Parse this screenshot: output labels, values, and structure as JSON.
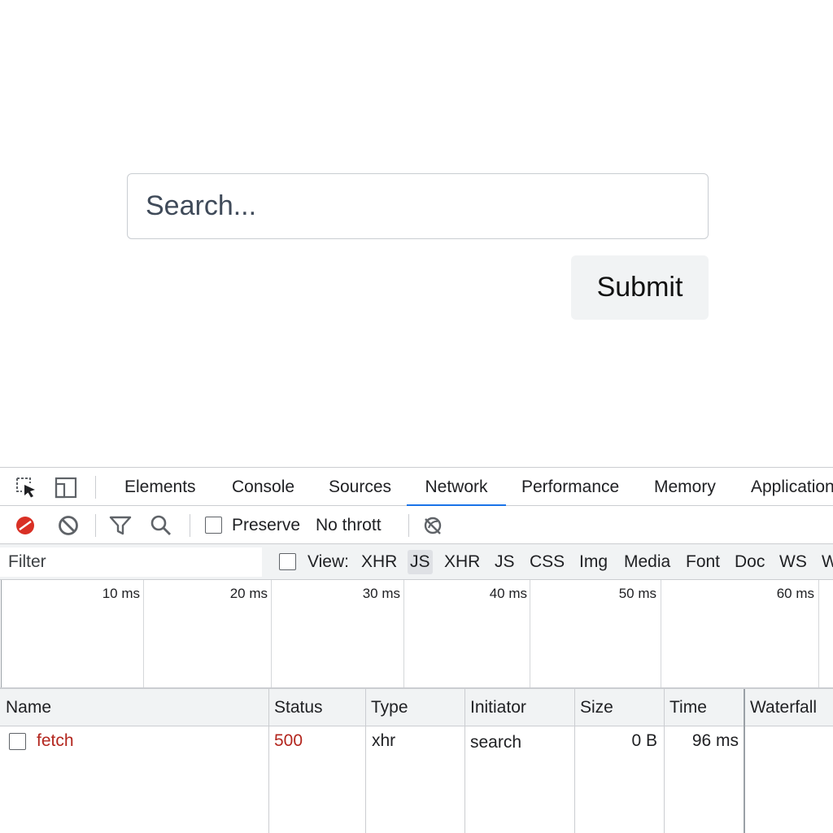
{
  "page": {
    "search_placeholder": "Search...",
    "submit_label": "Submit"
  },
  "devtools": {
    "tabs": [
      "Elements",
      "Console",
      "Sources",
      "Network",
      "Performance",
      "Memory",
      "Application"
    ],
    "active_tab": "Network",
    "accent_color": "#1a73e8",
    "toolbar": {
      "preserve_label": "Preserve",
      "throttle_label": "No thrott"
    },
    "filterbar": {
      "filter_placeholder": "Filter",
      "view_label": "View:",
      "types": [
        "XHR",
        "JS",
        "XHR",
        "JS",
        "CSS",
        "Img",
        "Media",
        "Font",
        "Doc",
        "WS",
        "W"
      ],
      "selected_type_index": 1
    },
    "overview_ticks": [
      "10 ms",
      "20 ms",
      "30 ms",
      "40 ms",
      "50 ms",
      "60 ms"
    ],
    "table": {
      "columns": [
        "Name",
        "Status",
        "Type",
        "Initiator",
        "Size",
        "Time",
        "Waterfall"
      ],
      "rows": [
        {
          "name": "fetch",
          "status": "500",
          "type": "xhr",
          "initiator": "search",
          "size": "0 B",
          "time": "96 ms"
        }
      ],
      "error_color": "#b3261e"
    }
  }
}
